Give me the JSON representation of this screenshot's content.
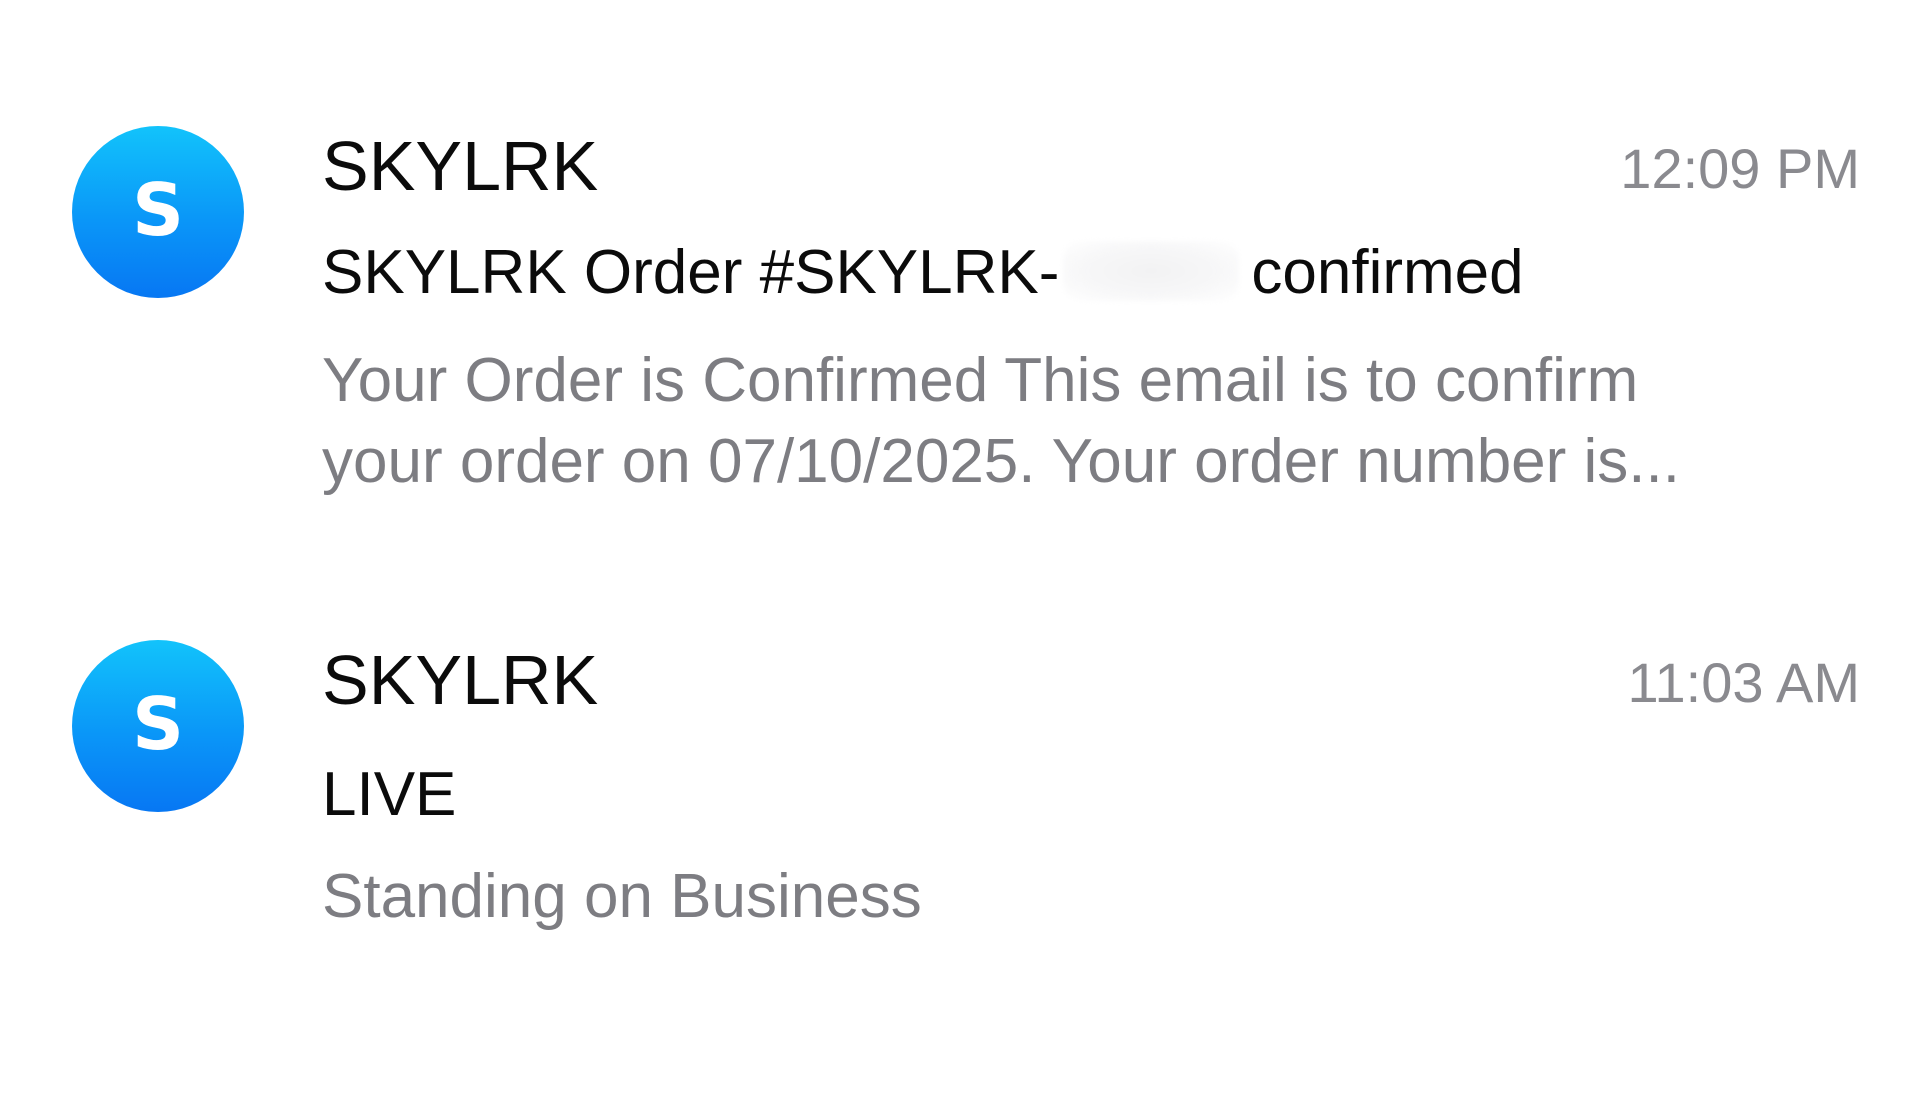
{
  "messages": [
    {
      "avatar_letter": "S",
      "sender": "SKYLRK",
      "time": "12:09 PM",
      "subject_before": "SKYLRK Order #SKYLRK-",
      "subject_after": "confirmed",
      "preview_lines": [
        "Your Order is Confirmed This email is to confirm",
        "your order on 07/10/2025. Your order number is..."
      ]
    },
    {
      "avatar_letter": "S",
      "sender": "SKYLRK",
      "time": "11:03 AM",
      "subject": "LIVE",
      "preview_lines": [
        "Standing on Business"
      ]
    }
  ],
  "colors": {
    "avatar_top": "#12c3fb",
    "avatar_bottom": "#0777f3",
    "primary_text": "#0b0b0b",
    "secondary_text": "#7d7d82",
    "time_text": "#8a8a8f"
  }
}
